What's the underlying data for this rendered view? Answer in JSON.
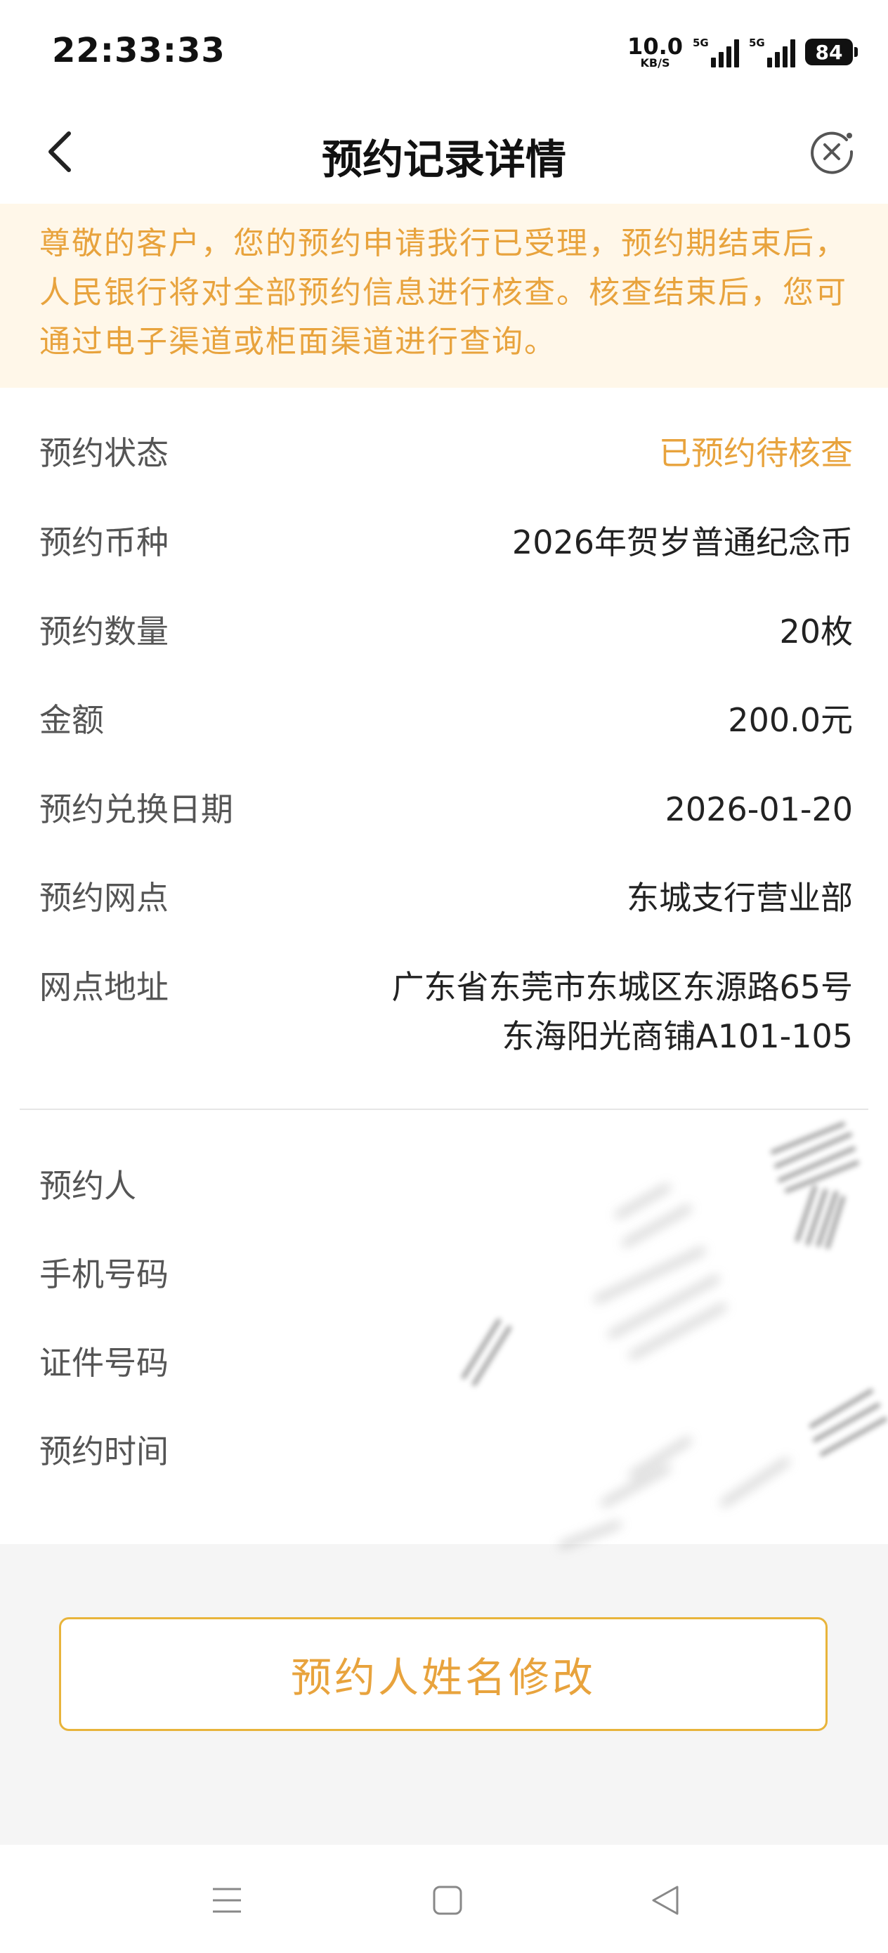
{
  "status_bar": {
    "time": "22:33:33",
    "net_speed": "10.0",
    "net_unit": "KB/S",
    "sim1_tag": "5G",
    "sim2_tag": "5G",
    "battery": "84"
  },
  "header": {
    "title": "预约记录详情",
    "back_icon": "chevron-left-icon",
    "close_icon": "close-circle-icon"
  },
  "notice": {
    "text": "尊敬的客户，您的预约申请我行已受理，预约期结束后，人民银行将对全部预约信息进行核查。核查结束后，您可通过电子渠道或柜面渠道进行查询。",
    "color": "#e8a33d",
    "background": "#fff7e9"
  },
  "details": {
    "status": {
      "label": "预约状态",
      "value": "已预约待核查"
    },
    "currency": {
      "label": "预约币种",
      "value": "2026年贺岁普通纪念币"
    },
    "quantity": {
      "label": "预约数量",
      "value": "20枚"
    },
    "amount": {
      "label": "金额",
      "value": "200.0元"
    },
    "exchange_date": {
      "label": "预约兑换日期",
      "value": "2026-01-20"
    },
    "branch": {
      "label": "预约网点",
      "value": "东城支行营业部"
    },
    "address": {
      "label": "网点地址",
      "line1": "广东省东莞市东城区东源路65号",
      "line2": "东海阳光商铺A101-105"
    }
  },
  "personal": {
    "name": {
      "label": "预约人"
    },
    "phone": {
      "label": "手机号码"
    },
    "id_number": {
      "label": "证件号码"
    },
    "time": {
      "label": "预约时间"
    }
  },
  "action": {
    "edit_name_label": "预约人姓名修改",
    "accent": "#e8b43b"
  },
  "nav": {
    "menu_icon": "menu-icon",
    "home_icon": "square-home-icon",
    "back_icon": "triangle-back-icon"
  }
}
